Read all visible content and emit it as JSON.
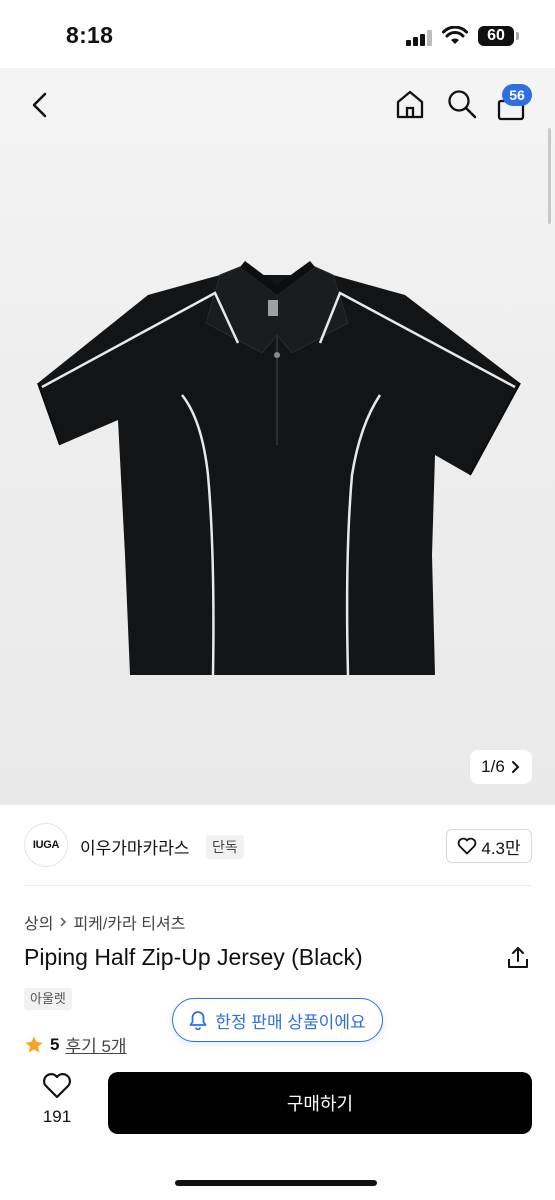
{
  "status_bar": {
    "time": "8:18",
    "battery": "60"
  },
  "nav": {
    "cart_count": "56"
  },
  "gallery": {
    "current": "1",
    "total": "6",
    "pager_text": "1/6"
  },
  "brand": {
    "logo_text": "IUGA",
    "name": "이우가마카라스",
    "tag": "단독",
    "likes": "4.3만"
  },
  "product": {
    "breadcrumb": [
      "상의",
      "피케/카라 티셔츠"
    ],
    "title": "Piping Half Zip-Up Jersey (Black)",
    "tag": "아울렛",
    "limited_label": "한정 판매 상품이에요",
    "rating": "5",
    "review_label": "후기 5개"
  },
  "bottom_bar": {
    "wish_count": "191",
    "buy_label": "구매하기"
  },
  "colors": {
    "accent": "#2f6fe4",
    "buy_button": "#000000",
    "star": "#f5a623"
  }
}
